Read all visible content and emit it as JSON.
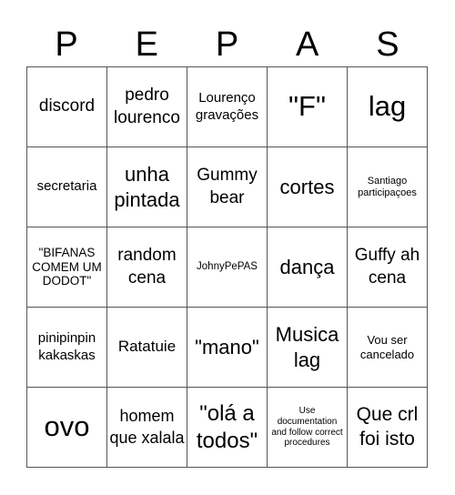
{
  "header": {
    "letters": [
      "P",
      "E",
      "P",
      "A",
      "S"
    ]
  },
  "cells": [
    [
      "discord",
      "pedro lourenco",
      "Lourenço gravações",
      "\"F\"",
      "lag"
    ],
    [
      "secretaria",
      "unha pintada",
      "Gummy bear",
      "cortes",
      "Santiago participaçoes"
    ],
    [
      "\"BIFANAS COMEM UM DODOT\"",
      "random cena",
      "JohnyPePAS",
      "dança",
      "Guffy ah cena"
    ],
    [
      "pinipinpin kakaskas",
      "Ratatuie",
      "\"mano\"",
      "Musica lag",
      "Vou ser cancelado"
    ],
    [
      "ovo",
      "homem que xalala",
      "\"olá a todos\"",
      "Use documentation and follow correct procedures",
      "Que crl foi isto"
    ]
  ]
}
